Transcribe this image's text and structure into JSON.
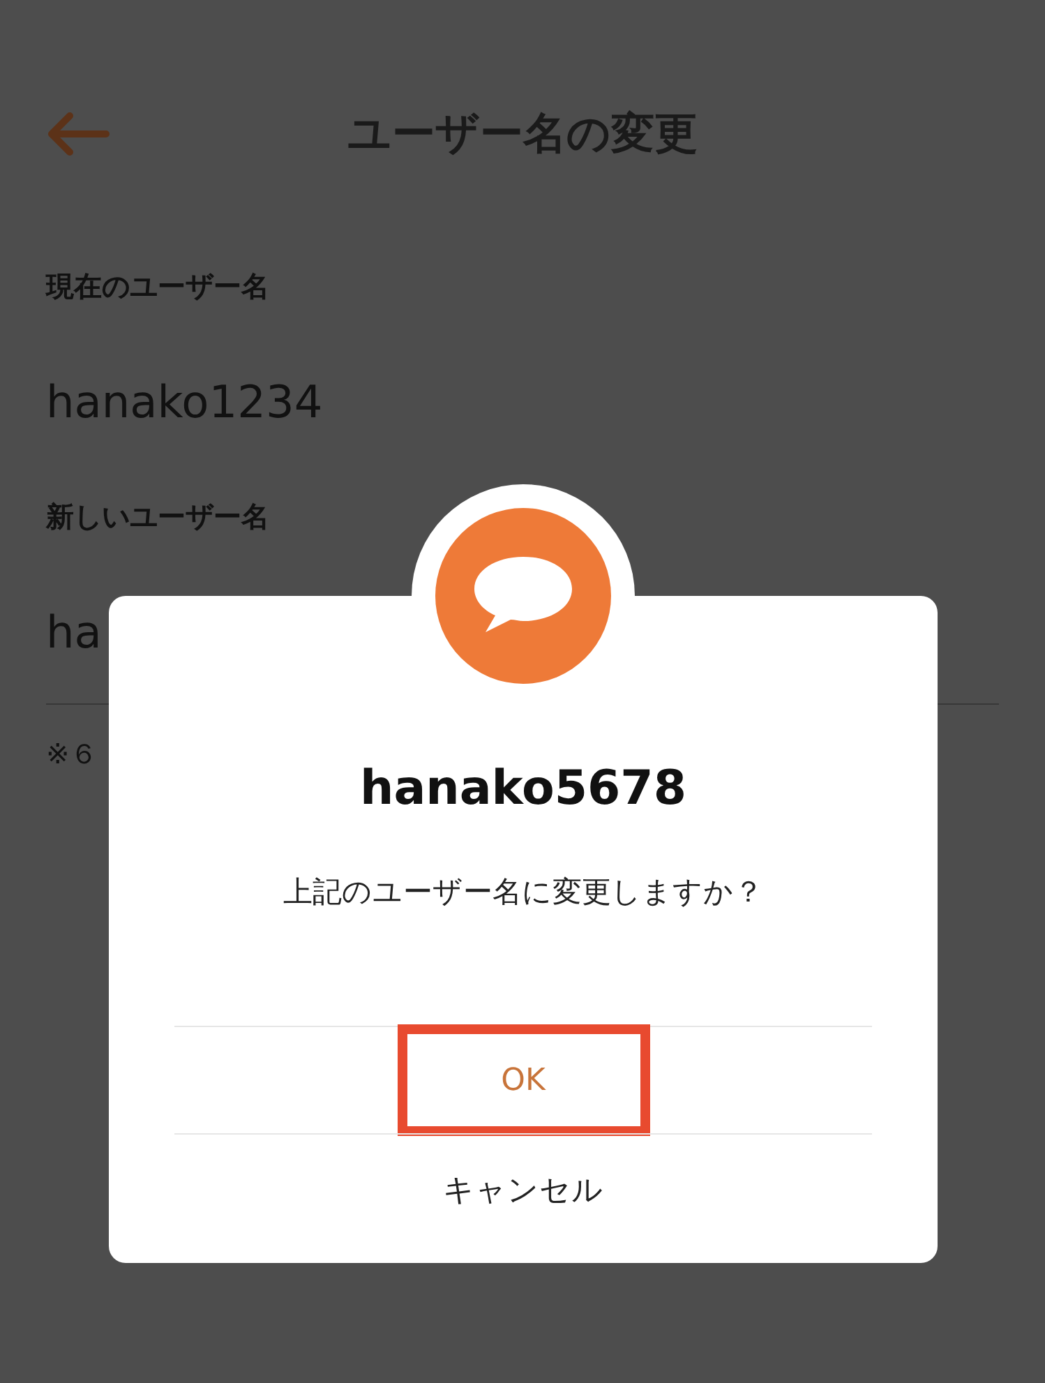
{
  "header": {
    "title": "ユーザー名の変更"
  },
  "current": {
    "label": "現在のユーザー名",
    "value": "hanako1234"
  },
  "new": {
    "label": "新しいユーザー名",
    "value": "ha"
  },
  "note": "※６",
  "dialog": {
    "title": "hanako5678",
    "message": "上記のユーザー名に変更しますか？",
    "buttons": [
      {
        "label": "OK",
        "kind": "primary",
        "highlighted": true
      },
      {
        "label": "キャンセル",
        "kind": "secondary",
        "highlighted": false
      }
    ]
  }
}
